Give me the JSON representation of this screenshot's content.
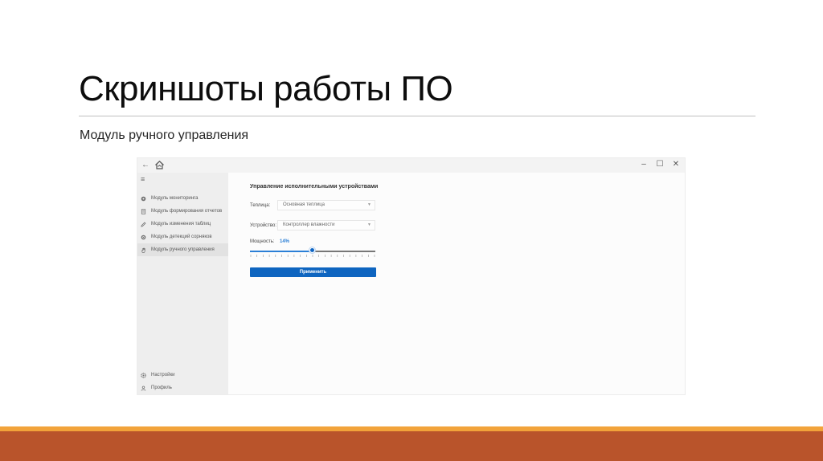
{
  "slide": {
    "title": "Скриншоты работы ПО",
    "subtitle": "Модуль ручного управления"
  },
  "window": {
    "back_label": "←",
    "logo_icon": "house-logo-icon",
    "controls": {
      "minimize": "–",
      "maximize": "☐",
      "close": "✕"
    }
  },
  "sidebar": {
    "menu_icon": "≡",
    "items": [
      {
        "label": "Модуль мониторинга",
        "icon": "eye-icon",
        "active": false
      },
      {
        "label": "Модуль формирования отчетов",
        "icon": "document-icon",
        "active": false
      },
      {
        "label": "Модуль изменения таблиц",
        "icon": "pencil-icon",
        "active": false
      },
      {
        "label": "Модуль детекций сорняков",
        "icon": "target-icon",
        "active": false
      },
      {
        "label": "Модуль ручного управления",
        "icon": "hand-icon",
        "active": true
      }
    ],
    "bottom_items": [
      {
        "label": "Настройки",
        "icon": "gear-icon"
      },
      {
        "label": "Профиль",
        "icon": "person-icon"
      }
    ]
  },
  "content": {
    "section_title": "Управление исполнительными устройствами",
    "greenhouse": {
      "label": "Теплица:",
      "value": "Основная теплица"
    },
    "device": {
      "label": "Устройство:",
      "value": "Контроллер влажности"
    },
    "power": {
      "label": "Мощность:",
      "value_label": "14%",
      "value": 0.5
    },
    "apply_label": "Применить"
  },
  "colors": {
    "accent": "#0e65c0",
    "footer_top": "#f2a33a",
    "footer_bottom": "#b9542b"
  }
}
